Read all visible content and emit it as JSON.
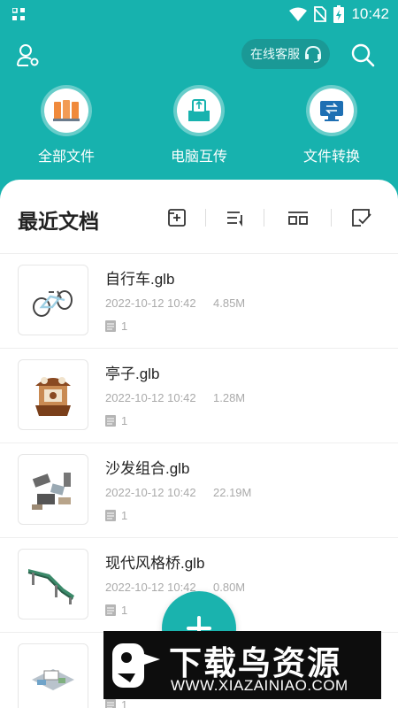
{
  "status_bar": {
    "time": "10:42"
  },
  "header": {
    "service_label": "在线客服"
  },
  "features": [
    {
      "label": "全部文件",
      "icon": "folders-icon"
    },
    {
      "label": "电脑互传",
      "icon": "pc-transfer-icon"
    },
    {
      "label": "文件转换",
      "icon": "convert-icon"
    }
  ],
  "recent": {
    "title": "最近文档",
    "files": [
      {
        "name": "自行车.glb",
        "date": "2022-10-12 10:42",
        "size": "4.85M",
        "pages": "1"
      },
      {
        "name": "亭子.glb",
        "date": "2022-10-12 10:42",
        "size": "1.28M",
        "pages": "1"
      },
      {
        "name": "沙发组合.glb",
        "date": "2022-10-12 10:42",
        "size": "22.19M",
        "pages": "1"
      },
      {
        "name": "现代风格桥.glb",
        "date": "2022-10-12 10:42",
        "size": "0.80M",
        "pages": "1"
      },
      {
        "name": "",
        "date": "",
        "size": "",
        "pages": "1"
      }
    ]
  },
  "watermark": {
    "title": "下载鸟资源",
    "url": "WWW.XIAZAINIAO.COM"
  },
  "colors": {
    "primary": "#17b2ae",
    "service_bg": "#1a9996",
    "fab": "#1ab3ae"
  }
}
